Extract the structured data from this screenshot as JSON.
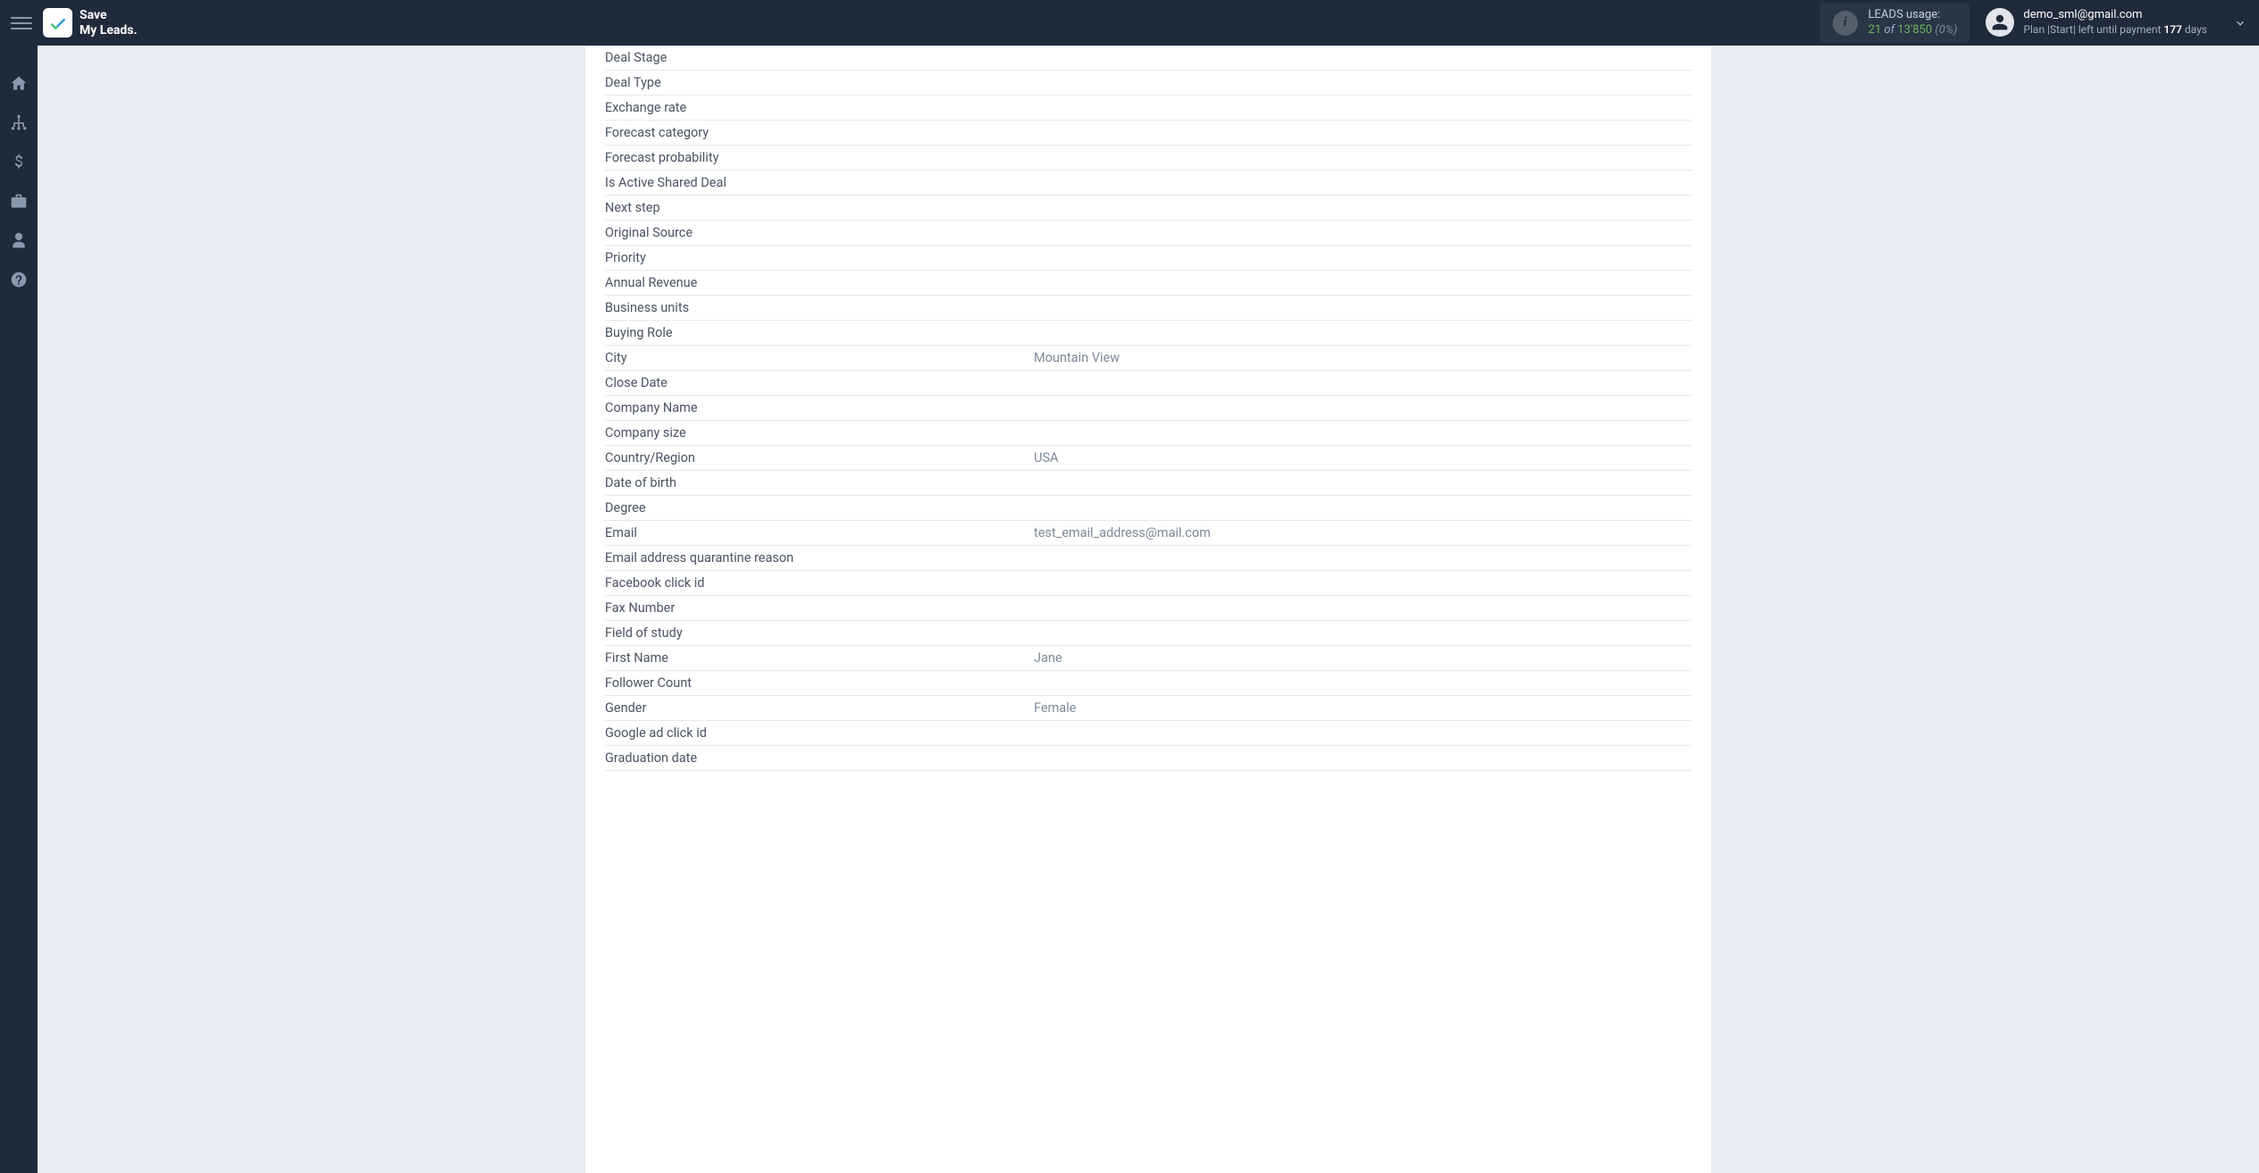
{
  "header": {
    "logo_line1": "Save",
    "logo_line2": "My Leads.",
    "leads_usage": {
      "label": "LEADS usage:",
      "used": "21",
      "of": "of",
      "total": "13'850",
      "pct": "(0%)"
    },
    "user": {
      "email": "demo_sml@gmail.com",
      "plan_prefix": "Plan |Start| left until payment ",
      "days": "177",
      "days_suffix": " days"
    }
  },
  "fields": [
    {
      "label": "Deal Stage",
      "value": ""
    },
    {
      "label": "Deal Type",
      "value": ""
    },
    {
      "label": "Exchange rate",
      "value": ""
    },
    {
      "label": "Forecast category",
      "value": ""
    },
    {
      "label": "Forecast probability",
      "value": ""
    },
    {
      "label": "Is Active Shared Deal",
      "value": ""
    },
    {
      "label": "Next step",
      "value": ""
    },
    {
      "label": "Original Source",
      "value": ""
    },
    {
      "label": "Priority",
      "value": ""
    },
    {
      "label": "Annual Revenue",
      "value": ""
    },
    {
      "label": "Business units",
      "value": ""
    },
    {
      "label": "Buying Role",
      "value": ""
    },
    {
      "label": "City",
      "value": "Mountain View"
    },
    {
      "label": "Close Date",
      "value": ""
    },
    {
      "label": "Company Name",
      "value": ""
    },
    {
      "label": "Company size",
      "value": ""
    },
    {
      "label": "Country/Region",
      "value": "USA"
    },
    {
      "label": "Date of birth",
      "value": ""
    },
    {
      "label": "Degree",
      "value": ""
    },
    {
      "label": "Email",
      "value": "test_email_address@mail.com"
    },
    {
      "label": "Email address quarantine reason",
      "value": ""
    },
    {
      "label": "Facebook click id",
      "value": ""
    },
    {
      "label": "Fax Number",
      "value": ""
    },
    {
      "label": "Field of study",
      "value": ""
    },
    {
      "label": "First Name",
      "value": "Jane"
    },
    {
      "label": "Follower Count",
      "value": ""
    },
    {
      "label": "Gender",
      "value": "Female"
    },
    {
      "label": "Google ad click id",
      "value": ""
    },
    {
      "label": "Graduation date",
      "value": ""
    }
  ]
}
